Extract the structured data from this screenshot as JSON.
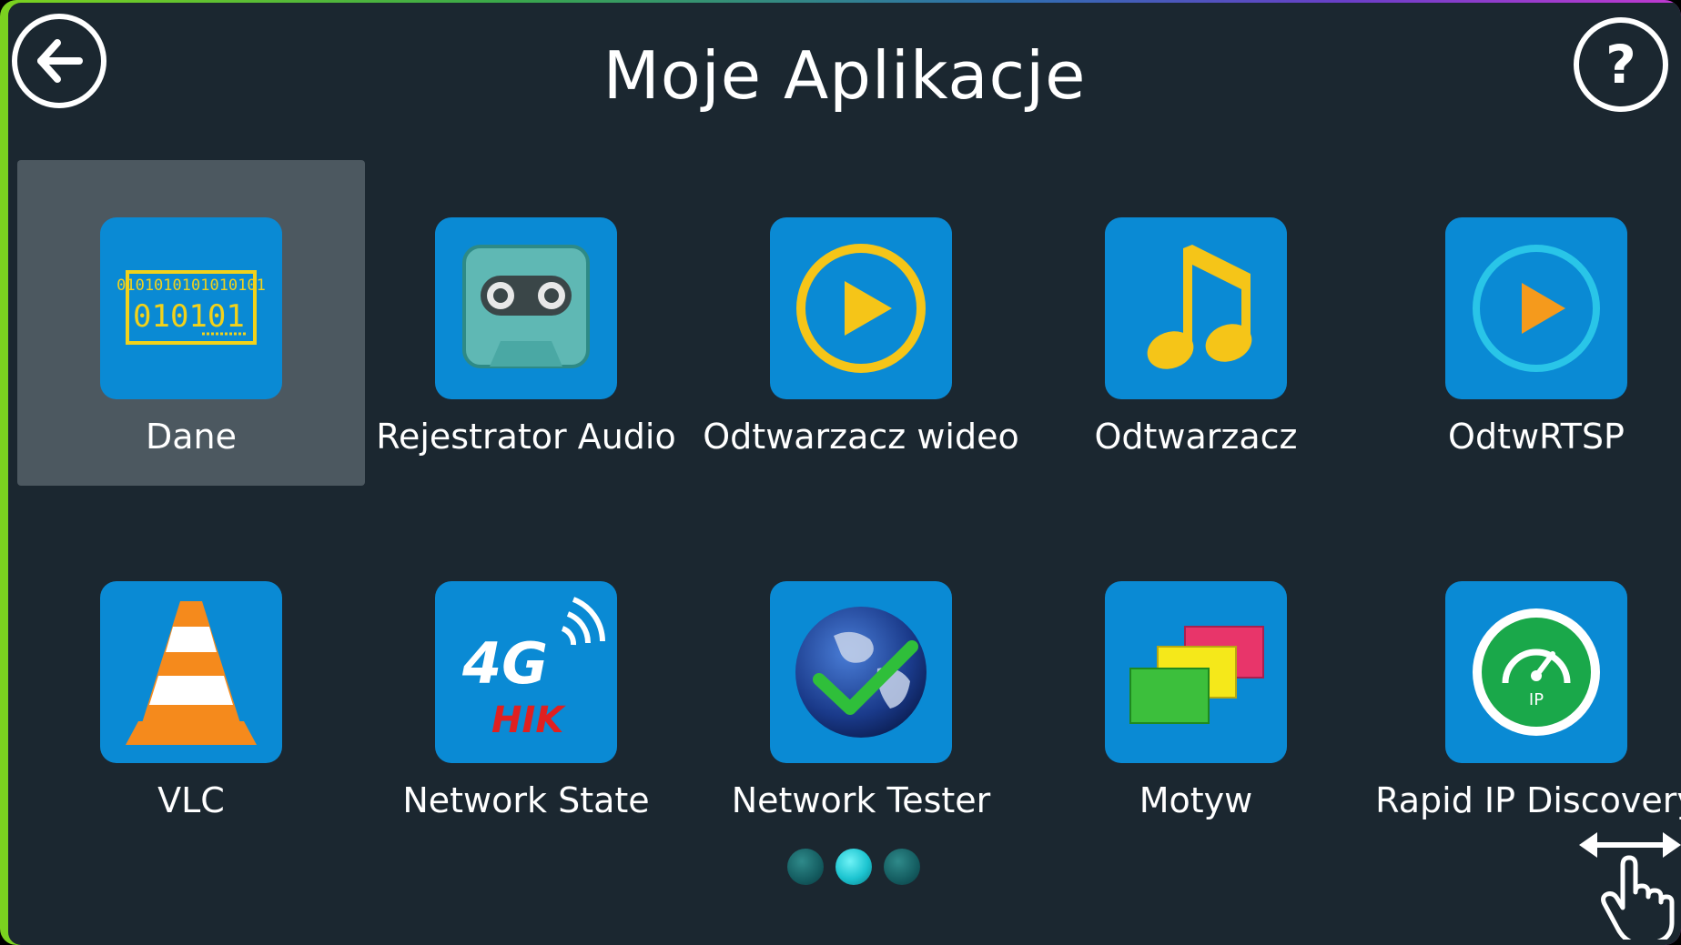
{
  "header": {
    "title": "Moje Aplikacje",
    "back_icon": "back-arrow-icon",
    "help_label": "?"
  },
  "apps": [
    {
      "label": "Dane",
      "icon": "binary-data-icon",
      "selected": true
    },
    {
      "label": "Rejestrator Audio",
      "icon": "cassette-icon",
      "selected": false
    },
    {
      "label": "Odtwarzacz wideo",
      "icon": "video-play-icon",
      "selected": false
    },
    {
      "label": "Odtwarzacz",
      "icon": "music-note-icon",
      "selected": false
    },
    {
      "label": "OdtwRTSP",
      "icon": "rtsp-play-icon",
      "selected": false
    },
    {
      "label": "VLC",
      "icon": "vlc-cone-icon",
      "selected": false
    },
    {
      "label": "Network State",
      "icon": "4g-hik-icon",
      "selected": false
    },
    {
      "label": "Network Tester",
      "icon": "globe-check-icon",
      "selected": false
    },
    {
      "label": "Motyw",
      "icon": "theme-cards-icon",
      "selected": false
    },
    {
      "label": "Rapid IP Discovery",
      "icon": "ip-gauge-icon",
      "selected": false
    }
  ],
  "icon_text": {
    "binary_top": "0101010101010101",
    "binary_bottom": "010101",
    "four_g": "4G",
    "hik": "HIK",
    "ip": "IP"
  },
  "pagination": {
    "pages": 3,
    "current": 2
  },
  "swipe_hint_icon": "swipe-hand-icon",
  "colors": {
    "background": "#1b2730",
    "tile_selected": "#4c5860",
    "icon_blue": "#0a8ad4",
    "text": "#ffffff"
  }
}
